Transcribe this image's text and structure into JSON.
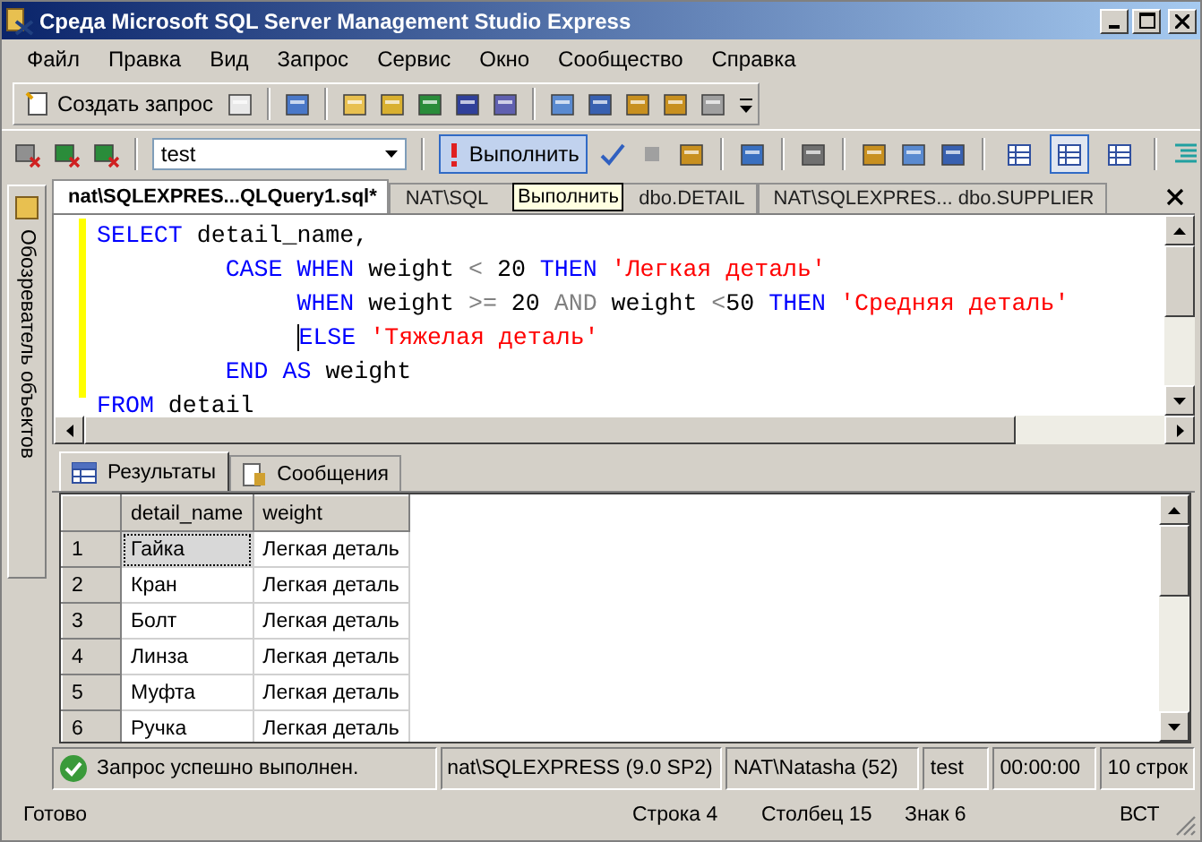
{
  "window": {
    "title": "Среда Microsoft SQL Server Management Studio Express"
  },
  "menu": [
    "Файл",
    "Правка",
    "Вид",
    "Запрос",
    "Сервис",
    "Окно",
    "Сообщество",
    "Справка"
  ],
  "toolbar": {
    "new_query": "Создать запрос",
    "database": "test",
    "execute": "Выполнить",
    "execute_hover": true,
    "result_modes": [
      {
        "selected": false
      },
      {
        "selected": true
      },
      {
        "selected": false
      }
    ]
  },
  "tooltip": "Выполнить",
  "side_panel": {
    "label": "Обозреватель объектов"
  },
  "editor_tabs": [
    {
      "parts": [
        "nat\\SQLEXPRES...QLQuery1.sql*"
      ],
      "selected": true
    },
    {
      "parts": [
        "NAT\\SQL",
        "dbo.DETAIL"
      ],
      "selected": false
    },
    {
      "parts": [
        "NAT\\SQLEXPRES... dbo.SUPPLIER"
      ],
      "selected": false
    }
  ],
  "code": [
    {
      "cursor": false,
      "tokens": [
        {
          "kind": "keyword",
          "text": "SELECT"
        },
        {
          "kind": "plain",
          "text": " detail_name,"
        }
      ]
    },
    {
      "cursor": false,
      "tokens": [
        {
          "kind": "keyword",
          "text": "         CASE WHEN"
        },
        {
          "kind": "plain",
          "text": " weight "
        },
        {
          "kind": "operator",
          "text": "<"
        },
        {
          "kind": "plain",
          "text": " 20 "
        },
        {
          "kind": "keyword",
          "text": "THEN"
        },
        {
          "kind": "string",
          "text": " 'Легкая деталь'"
        }
      ]
    },
    {
      "cursor": false,
      "tokens": [
        {
          "kind": "keyword",
          "text": "              WHEN"
        },
        {
          "kind": "plain",
          "text": " weight "
        },
        {
          "kind": "operator",
          "text": ">="
        },
        {
          "kind": "plain",
          "text": " 20 "
        },
        {
          "kind": "operator",
          "text": "AND"
        },
        {
          "kind": "plain",
          "text": " weight "
        },
        {
          "kind": "operator",
          "text": "<"
        },
        {
          "kind": "plain",
          "text": "50 "
        },
        {
          "kind": "keyword",
          "text": "THEN"
        },
        {
          "kind": "string",
          "text": " 'Средняя деталь'"
        }
      ]
    },
    {
      "cursor": true,
      "tokens": [
        {
          "kind": "keyword",
          "text": "              ELSE"
        },
        {
          "kind": "string",
          "text": " 'Тяжелая деталь'"
        }
      ]
    },
    {
      "cursor": false,
      "tokens": [
        {
          "kind": "keyword",
          "text": "         END AS"
        },
        {
          "kind": "plain",
          "text": " weight"
        }
      ]
    },
    {
      "cursor": false,
      "tokens": [
        {
          "kind": "keyword",
          "text": "FROM"
        },
        {
          "kind": "plain",
          "text": " detail"
        }
      ]
    }
  ],
  "result_tabs": [
    {
      "label": "Результаты",
      "kind": "grid",
      "selected": true
    },
    {
      "label": "Сообщения",
      "kind": "messages",
      "selected": false
    }
  ],
  "table": {
    "columns": [
      "detail_name",
      "weight"
    ],
    "rows": [
      {
        "number": "1",
        "cells": [
          "Гайка",
          "Легкая деталь"
        ],
        "selected": true
      },
      {
        "number": "2",
        "cells": [
          "Кран",
          "Легкая деталь"
        ],
        "selected": false
      },
      {
        "number": "3",
        "cells": [
          "Болт",
          "Легкая деталь"
        ],
        "selected": false
      },
      {
        "number": "4",
        "cells": [
          "Линза",
          "Легкая деталь"
        ],
        "selected": false
      },
      {
        "number": "5",
        "cells": [
          "Муфта",
          "Легкая деталь"
        ],
        "selected": false
      },
      {
        "number": "6",
        "cells": [
          "Ручка",
          "Легкая деталь"
        ],
        "selected": false
      }
    ]
  },
  "query_status": {
    "message": "Запрос успешно выполнен.",
    "server": "nat\\SQLEXPRESS (9.0 SP2)",
    "user": "NAT\\Natasha (52)",
    "database": "test",
    "time": "00:00:00",
    "rows": "10 строк"
  },
  "status_bar": {
    "state": "Готово",
    "line": "Строка 4",
    "column": "Столбец 15",
    "char": "Знак 6",
    "mode": "ВСТ"
  }
}
